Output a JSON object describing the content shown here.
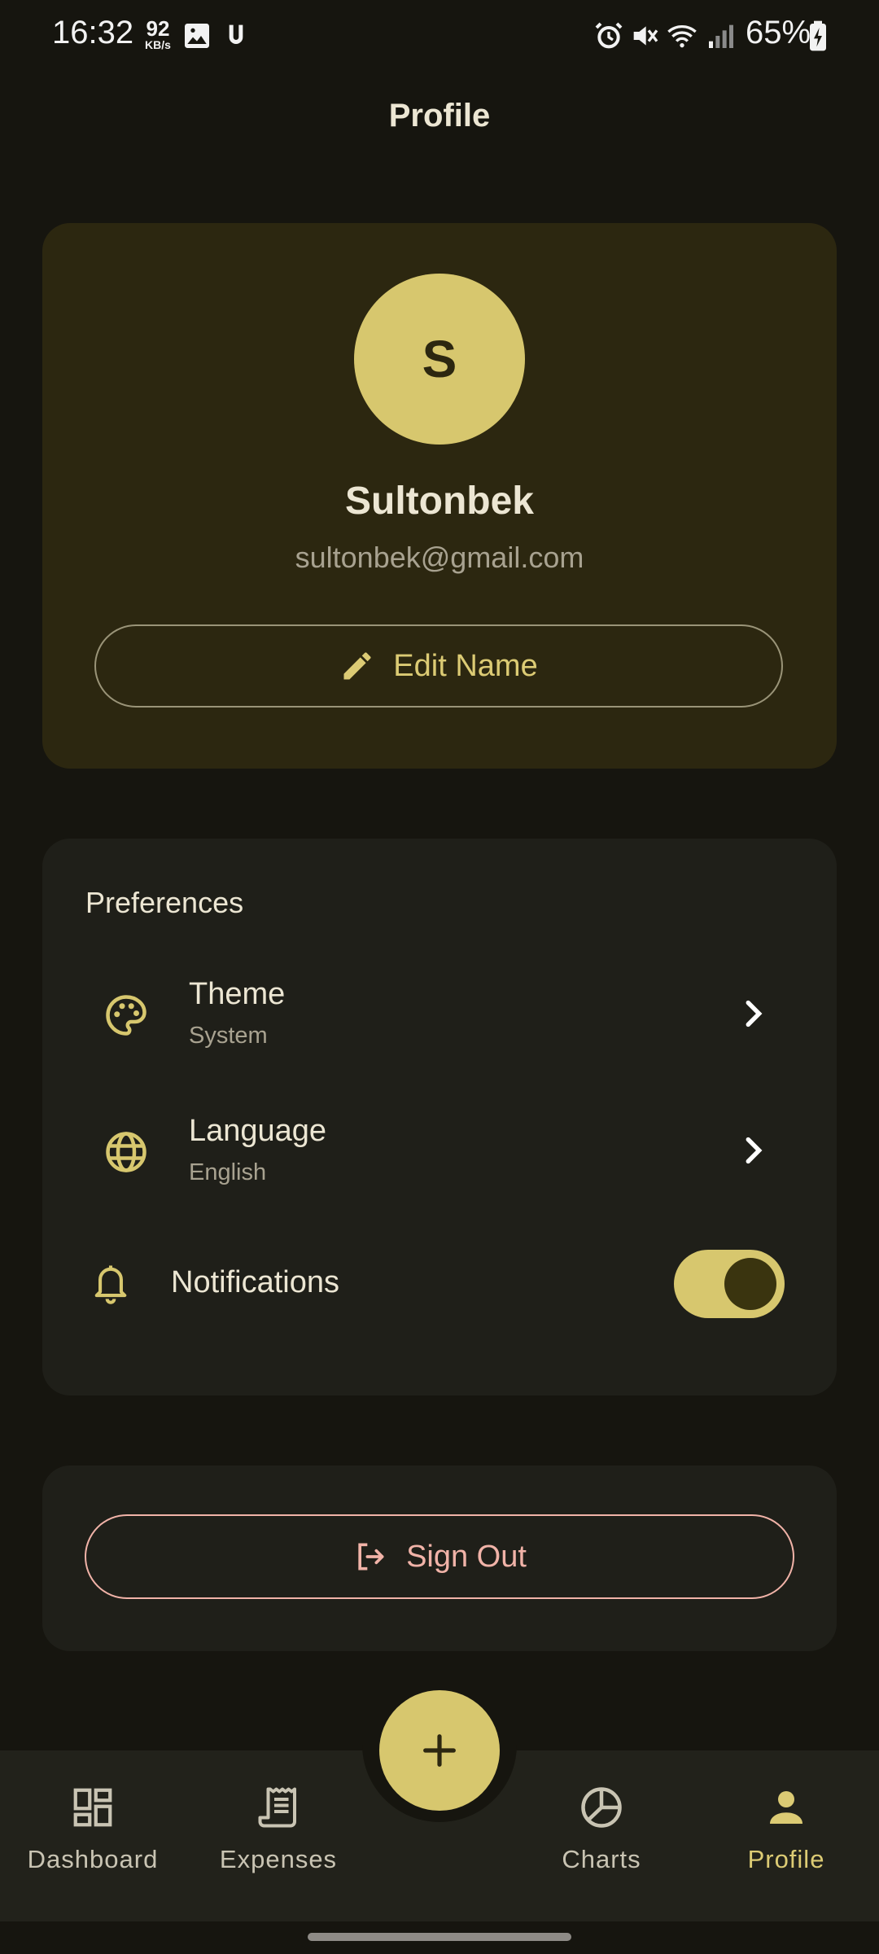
{
  "status_bar": {
    "time": "16:32",
    "speed_value": "92",
    "speed_unit": "KB/s",
    "battery": "65%"
  },
  "header": {
    "title": "Profile"
  },
  "profile": {
    "avatar_initial": "S",
    "name": "Sultonbek",
    "email": "sultonbek@gmail.com",
    "edit_label": "Edit Name"
  },
  "preferences": {
    "title": "Preferences",
    "items": [
      {
        "label": "Theme",
        "value": "System",
        "icon": "palette-icon"
      },
      {
        "label": "Language",
        "value": "English",
        "icon": "globe-icon"
      }
    ],
    "notifications": {
      "label": "Notifications",
      "enabled": true
    }
  },
  "sign_out": {
    "label": "Sign Out"
  },
  "bottom_nav": {
    "items": [
      {
        "label": "Dashboard",
        "icon": "dashboard-icon",
        "active": false
      },
      {
        "label": "Expenses",
        "icon": "receipt-icon",
        "active": false
      },
      {
        "label": "Charts",
        "icon": "pie-chart-icon",
        "active": false
      },
      {
        "label": "Profile",
        "icon": "person-icon",
        "active": true
      }
    ],
    "fab_icon": "plus-icon"
  },
  "colors": {
    "accent": "#d7c76e",
    "danger": "#f1b3a8",
    "background": "#16150f",
    "card": "#1f1f19"
  }
}
